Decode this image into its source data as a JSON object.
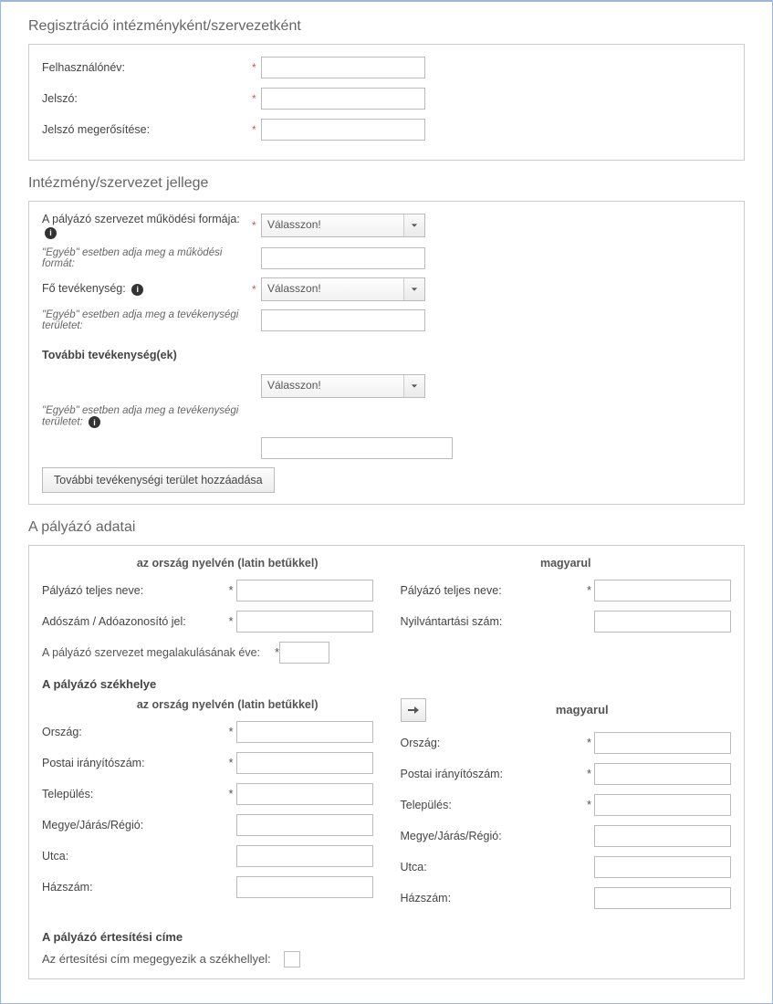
{
  "page_title": "Regisztráció intézményként/szervezetként",
  "account": {
    "username_label": "Felhasználónév:",
    "password_label": "Jelszó:",
    "password_confirm_label": "Jelszó megerősítése:"
  },
  "org": {
    "section_title": "Intézmény/szervezet jellege",
    "form_label": "A pályázó szervezet működési formája:",
    "select_placeholder": "Válasszon!",
    "other_form_label": "\"Egyéb\" esetben adja meg a működési formát:",
    "main_activity_label": "Fő tevékenység:",
    "other_activity_label": "\"Egyéb\" esetben adja meg a tevékenységi területet:",
    "more_activities_label": "További tevékenység(ek)",
    "other_more_label": "\"Egyéb\" esetben adja meg a tevékenységi területet:",
    "add_button": "További tevékenységi terület hozzáadása"
  },
  "applicant": {
    "section_title": "A pályázó adatai",
    "col_native": "az ország nyelvén (latin betűkkel)",
    "col_hu": "magyarul",
    "fullname_label": "Pályázó teljes neve:",
    "taxid_label": "Adószám / Adóazonosító jel:",
    "regnum_label": "Nyilvántartási szám:",
    "est_year_label": "A pályázó szervezet megalakulásának éve:",
    "seat_title": "A pályázó székhelye",
    "country_label": "Ország:",
    "zip_label": "Postai irányítószám:",
    "city_label": "Település:",
    "region_label": "Megye/Járás/Régió:",
    "street_label": "Utca:",
    "house_label": "Házszám:",
    "notif_title": "A pályázó értesítési címe",
    "same_addr_label": "Az értesítési cím megegyezik a székhellyel:"
  }
}
